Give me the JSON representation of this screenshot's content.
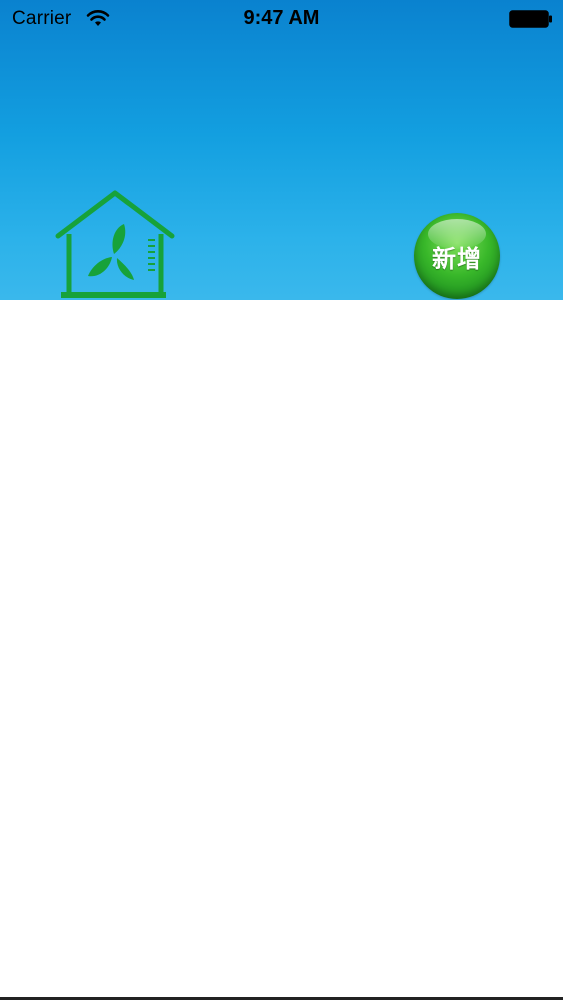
{
  "status_bar": {
    "carrier": "Carrier",
    "time": "9:47 AM",
    "wifi_icon": "wifi-icon",
    "battery_icon": "battery-icon"
  },
  "header": {
    "logo_icon": "house-fan-icon",
    "add_button_label": "新增",
    "colors": {
      "sky_top": "#0a82cf",
      "sky_bottom": "#3ab8ec",
      "logo_green": "#17a23a",
      "button_green": "#39b82a"
    }
  }
}
